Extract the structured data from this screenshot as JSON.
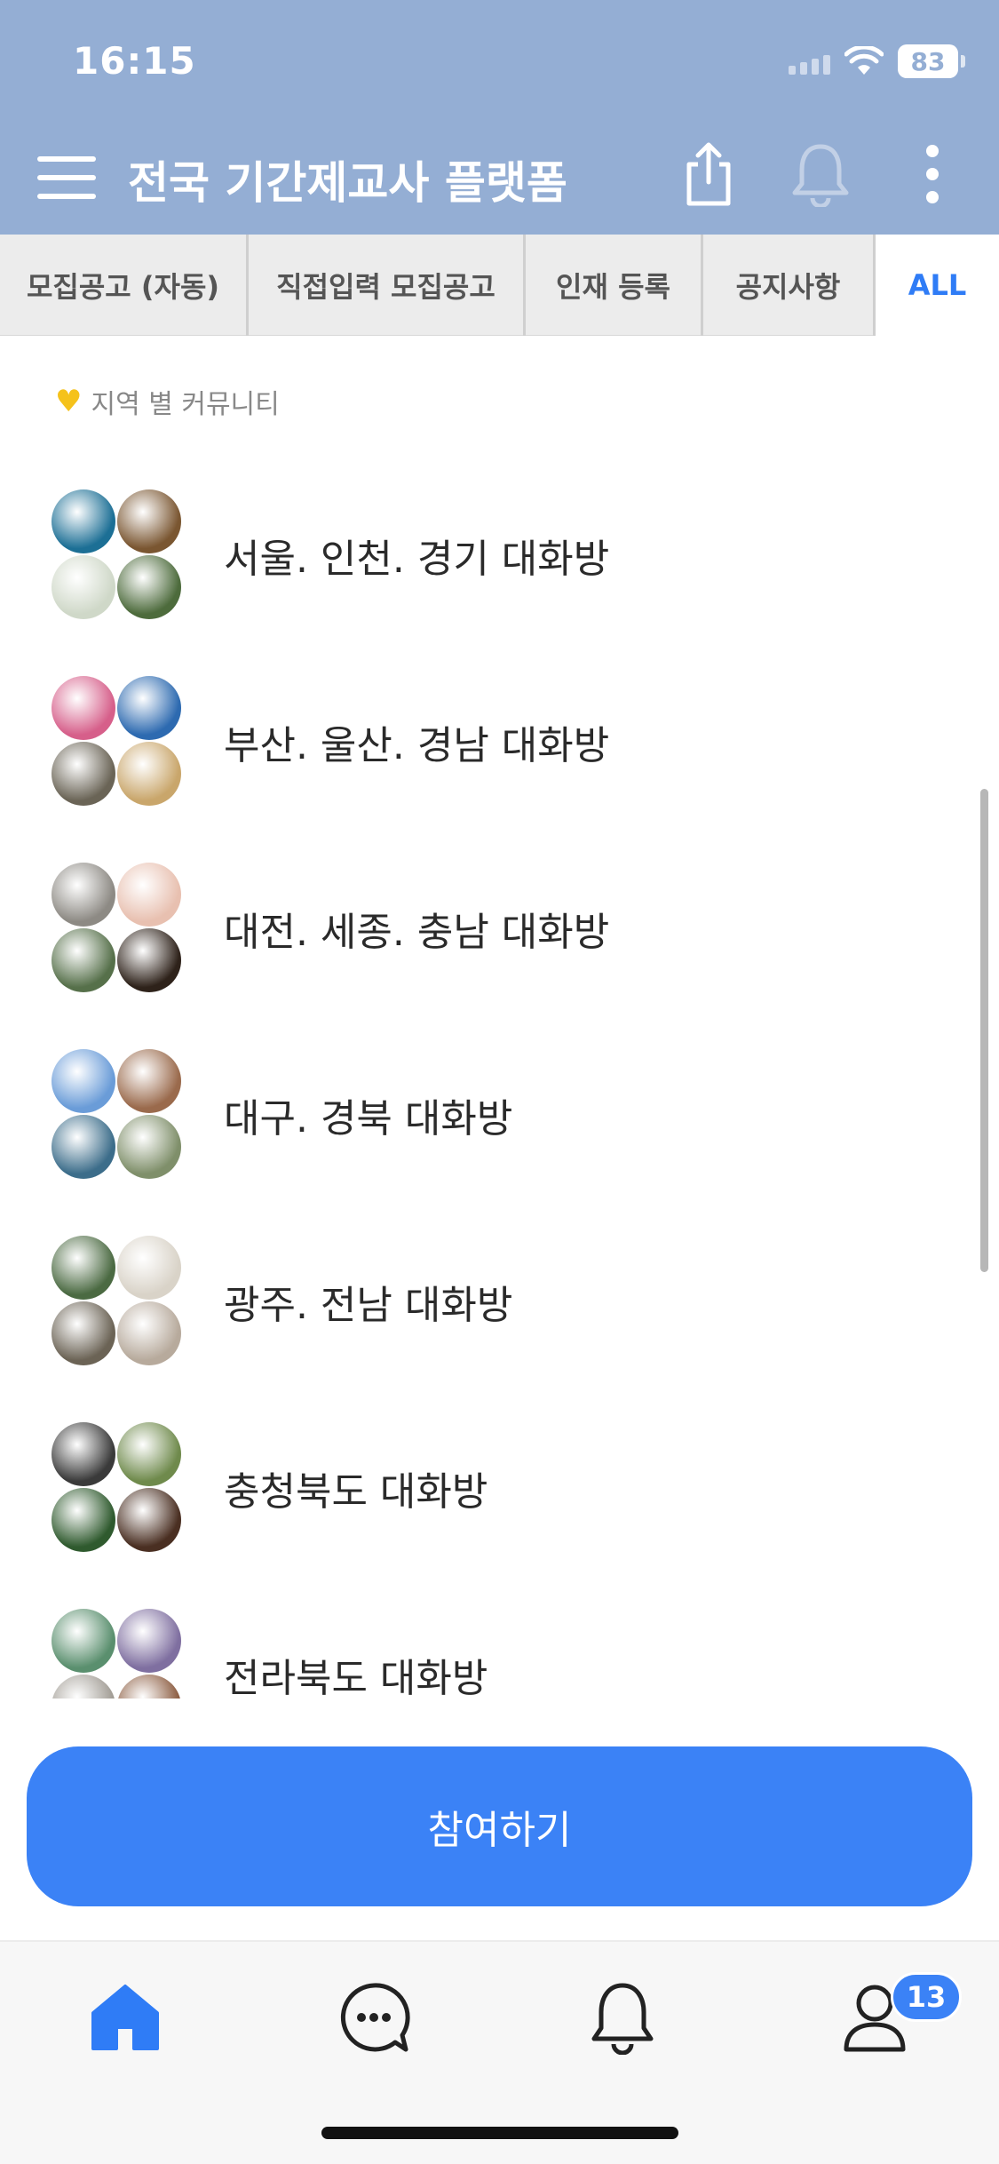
{
  "status_bar": {
    "time": "16:15",
    "battery": "83"
  },
  "header": {
    "title": "전국 기간제교사 플랫폼",
    "icons": [
      "menu-icon",
      "share-icon",
      "bell-icon",
      "more-vertical-icon"
    ]
  },
  "tabs": [
    {
      "label": "모집공고 (자동)",
      "active": false
    },
    {
      "label": "직접입력 모집공고",
      "active": false
    },
    {
      "label": "인재 등록",
      "active": false
    },
    {
      "label": "공지사항",
      "active": false
    },
    {
      "label": "ALL",
      "active": true
    }
  ],
  "section": {
    "icon": "heart-icon",
    "label": "지역 별 커뮤니티"
  },
  "rooms": [
    {
      "name": "서울. 인천. 경기 대화방",
      "avatars": [
        "#1c6f95",
        "#7a5631",
        "#cfd8c8",
        "#4d6b3c"
      ]
    },
    {
      "name": "부산. 울산. 경남 대화방",
      "avatars": [
        "#d65f8a",
        "#2d6ab0",
        "#6a6456",
        "#c9a66b"
      ]
    },
    {
      "name": "대전. 세종. 충남 대화방",
      "avatars": [
        "#8d8a84",
        "#e8c0b0",
        "#56704a",
        "#2e221a"
      ]
    },
    {
      "name": "대구. 경북 대화방",
      "avatars": [
        "#6a9cd8",
        "#9a6a4c",
        "#3c6d8a",
        "#7f8f6a"
      ]
    },
    {
      "name": "광주. 전남 대화방",
      "avatars": [
        "#4b6a42",
        "#d9d3c8",
        "#6b6355",
        "#b7aa9c"
      ]
    },
    {
      "name": "충청북도 대화방",
      "avatars": [
        "#3a3a3a",
        "#6f8a4c",
        "#2f5a2e",
        "#4a2f22"
      ]
    },
    {
      "name": "전라북도 대화방",
      "avatars": [
        "#5a8f6e",
        "#7f6fa0",
        "#9f9a92",
        "#8a5a3e"
      ]
    }
  ],
  "join_button": {
    "label": "참여하기"
  },
  "bottom_nav": {
    "items": [
      "home-icon",
      "chat-icon",
      "bell-icon",
      "profile-icon"
    ],
    "badge": "13"
  },
  "colors": {
    "header": "#94aed4",
    "accent": "#3b82f6",
    "tab_active": "#2f7cf6"
  }
}
